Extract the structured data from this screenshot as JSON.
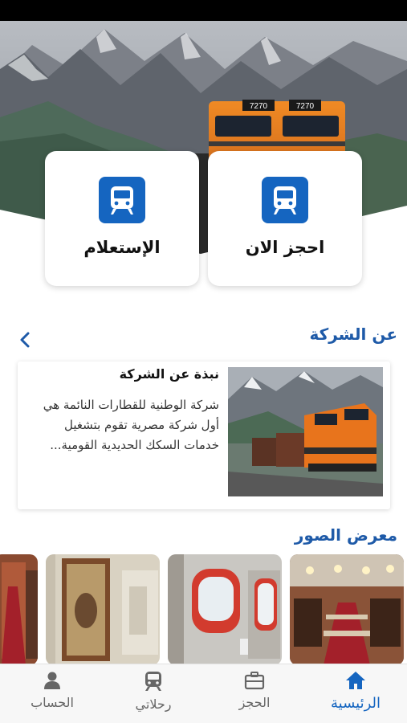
{
  "actions": {
    "book_now": "احجز الان",
    "inquiry": "الإستعلام"
  },
  "hero": {
    "locomotive_number_left": "7270",
    "locomotive_number_right": "7270"
  },
  "about": {
    "section_title": "عن الشركة",
    "card_title": "نبذة عن الشركة",
    "card_body": "شركة الوطنية للقطارات النائمة هي أول شركة مصرية تقوم بتشغيل خدمات السكك الحديدية القومية..."
  },
  "gallery": {
    "section_title": "معرض الصور"
  },
  "nav": {
    "home": "الرئيسية",
    "booking": "الحجز",
    "trips": "رحلاتي",
    "account": "الحساب"
  },
  "colors": {
    "accent": "#1565c0",
    "section_title": "#1e5aa8"
  },
  "icons": {
    "action": "train-icon",
    "chevron": "chevron-left-icon",
    "home": "home-icon",
    "booking": "briefcase-icon",
    "trips": "train-icon",
    "account": "person-icon"
  }
}
